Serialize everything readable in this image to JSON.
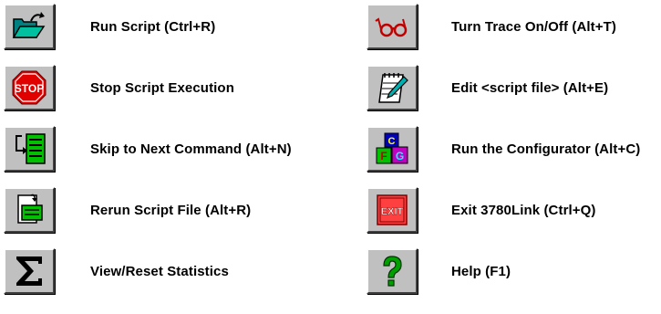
{
  "toolbar_legend": {
    "left_column": [
      {
        "icon": "open-folder-icon",
        "label": "Run Script (Ctrl+R)"
      },
      {
        "icon": "stop-sign-icon",
        "label": "Stop Script Execution",
        "icon_text": "STOP"
      },
      {
        "icon": "skip-next-icon",
        "label": "Skip to Next Command (Alt+N)"
      },
      {
        "icon": "rerun-file-icon",
        "label": "Rerun Script File (Alt+R)"
      },
      {
        "icon": "sigma-icon",
        "label": "View/Reset Statistics"
      }
    ],
    "right_column": [
      {
        "icon": "glasses-icon",
        "label": "Turn Trace On/Off (Alt+T)"
      },
      {
        "icon": "notepad-pencil-icon",
        "label": "Edit <script file> (Alt+E)"
      },
      {
        "icon": "configurator-blocks-icon",
        "label": "Run the Configurator (Alt+C)",
        "icon_letters": [
          "C",
          "F",
          "G"
        ]
      },
      {
        "icon": "exit-sign-icon",
        "label": "Exit 3780Link (Ctrl+Q)",
        "icon_text": "EXIT"
      },
      {
        "icon": "question-mark-icon",
        "label": "Help (F1)"
      }
    ]
  }
}
